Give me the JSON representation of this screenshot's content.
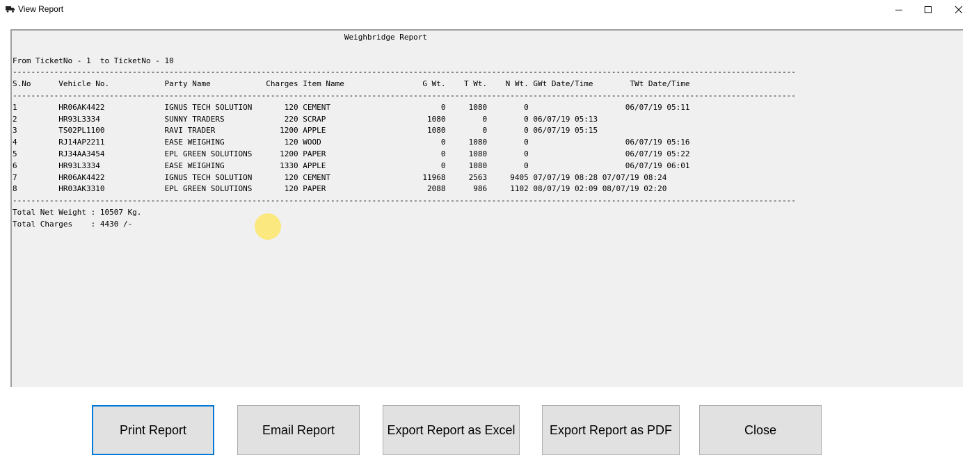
{
  "window": {
    "title": "View Report",
    "app_icon": "truck-icon",
    "controls": [
      "minimize-icon",
      "maximize-icon",
      "close-icon"
    ]
  },
  "report": {
    "lines": [
      "                                                                        Weighbridge Report",
      "",
      "From TicketNo - 1  to TicketNo - 10",
      "--------------------------------------------------------------------------------------------------------------------------------------------------------------------------",
      "S.No      Vehicle No.            Party Name            Charges Item Name                 G Wt.    T Wt.    N Wt. GWt Date/Time        TWt Date/Time",
      "--------------------------------------------------------------------------------------------------------------------------------------------------------------------------",
      "1         HR06AK4422             IGNUS TECH SOLUTION       120 CEMENT                        0     1080        0                     06/07/19 05:11",
      "2         HR93L3334              SUNNY TRADERS             220 SCRAP                      1080        0        0 06/07/19 05:13",
      "3         TS02PL1100             RAVI TRADER              1200 APPLE                      1080        0        0 06/07/19 05:15",
      "4         RJ14AP2211             EASE WEIGHING             120 WOOD                          0     1080        0                     06/07/19 05:16",
      "5         RJ34AA3454             EPL GREEN SOLUTIONS      1200 PAPER                         0     1080        0                     06/07/19 05:22",
      "6         HR93L3334              EASE WEIGHING            1330 APPLE                         0     1080        0                     06/07/19 06:01",
      "7         HR06AK4422             IGNUS TECH SOLUTION       120 CEMENT                    11968     2563     9405 07/07/19 08:28 07/07/19 08:24",
      "8         HR03AK3310             EPL GREEN SOLUTIONS       120 PAPER                      2088      986     1102 08/07/19 02:09 08/07/19 02:20",
      "--------------------------------------------------------------------------------------------------------------------------------------------------------------------------",
      "Total Net Weight : 10507 Kg.",
      "Total Charges    : 4430 /-"
    ]
  },
  "buttons": {
    "print": "Print Report",
    "email": "Email Report",
    "excel": "Export Report as Excel",
    "pdf": "Export Report as PDF",
    "close": "Close"
  }
}
